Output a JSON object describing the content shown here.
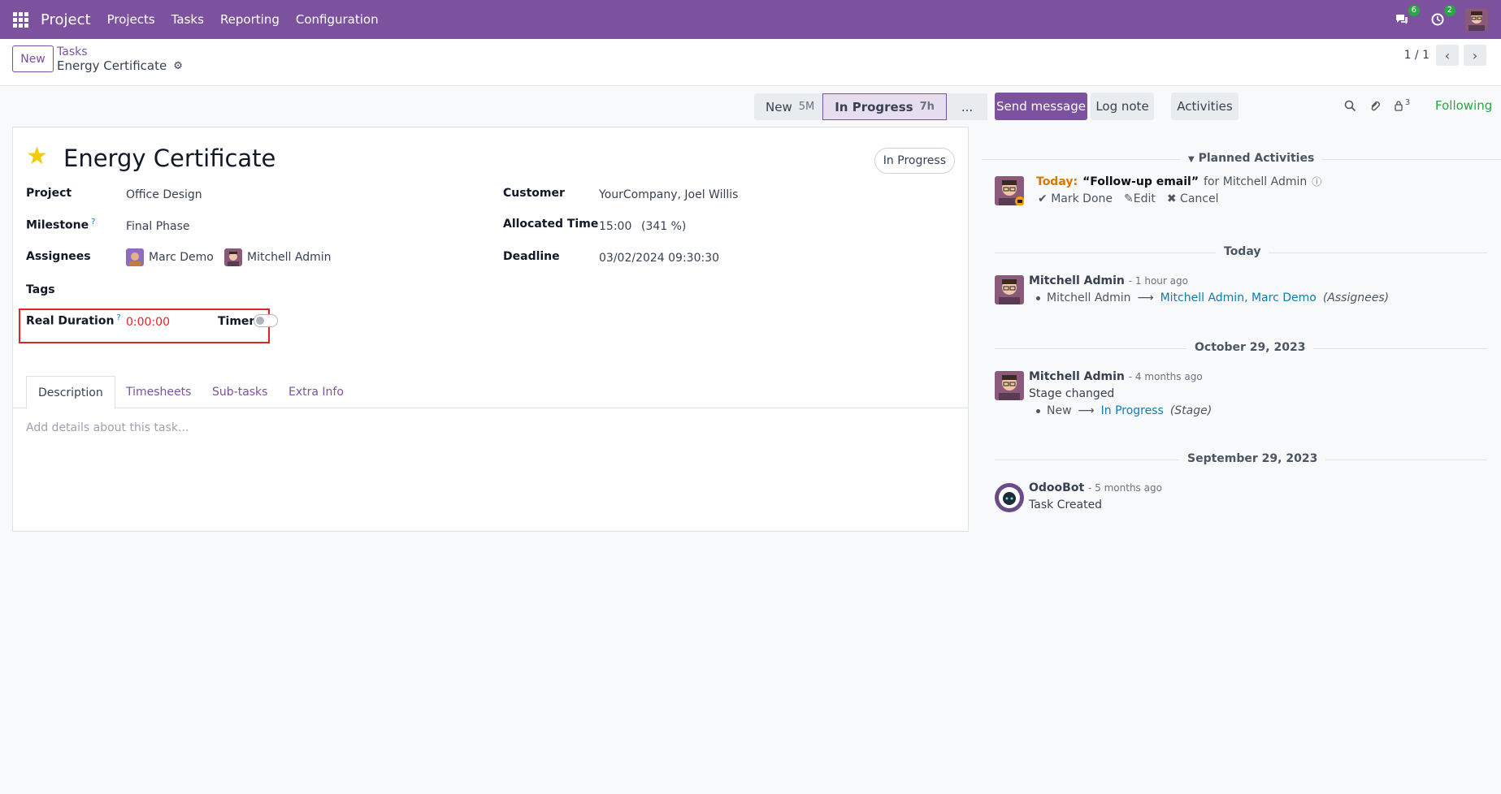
{
  "navbar": {
    "app_name": "Project",
    "menu": [
      "Projects",
      "Tasks",
      "Reporting",
      "Configuration"
    ],
    "messages_count": "6",
    "activities_count": "2",
    "background": "#7c519e"
  },
  "control_panel": {
    "new_label": "New",
    "breadcrumb_parent": "Tasks",
    "breadcrumb_current": "Energy Certificate",
    "pager": "1 / 1"
  },
  "statusbar": {
    "stages": [
      {
        "label": "New",
        "duration": "5M"
      },
      {
        "label": "In Progress",
        "duration": "7h"
      }
    ],
    "more_label": "..."
  },
  "form": {
    "title": "Energy Certificate",
    "state_badge": "In Progress",
    "fields": {
      "project_label": "Project",
      "project_value": "Office Design",
      "milestone_label": "Milestone",
      "milestone_value": "Final Phase",
      "assignees_label": "Assignees",
      "assignees": [
        "Marc Demo",
        "Mitchell Admin"
      ],
      "tags_label": "Tags",
      "real_duration_label": "Real Duration",
      "real_duration_value": "0:00:00",
      "timer_label": "Timer:",
      "customer_label": "Customer",
      "customer_value": "YourCompany, Joel Willis",
      "allocated_label": "Allocated Time",
      "allocated_value": "15:00",
      "allocated_pct": "(341 %)",
      "deadline_label": "Deadline",
      "deadline_value": "03/02/2024 09:30:30",
      "help_mark": "?"
    },
    "tabs": [
      "Description",
      "Timesheets",
      "Sub-tasks",
      "Extra Info"
    ],
    "description_placeholder": "Add details about this task..."
  },
  "chatter": {
    "send_message": "Send message",
    "log_note": "Log note",
    "activities": "Activities",
    "followers_count": "3",
    "following": "Following",
    "planned_title": "Planned Activities",
    "planned": {
      "when": "Today:",
      "summary": "“Follow-up email”",
      "for": "for Mitchell Admin",
      "actions": [
        "Mark Done",
        "Edit",
        "Cancel"
      ]
    },
    "groups": [
      {
        "date": "Today",
        "author": "Mitchell Admin",
        "ago": "- 1 hour ago",
        "text": "",
        "old": "Mitchell Admin",
        "new": "Mitchell Admin, Marc Demo",
        "field": "(Assignees)"
      },
      {
        "date": "October 29, 2023",
        "author": "Mitchell Admin",
        "ago": "- 4 months ago",
        "text": "Stage changed",
        "old": "New",
        "new": "In Progress",
        "field": "(Stage)"
      },
      {
        "date": "September 29, 2023",
        "author": "OdooBot",
        "ago": "- 5 months ago",
        "text": "Task Created"
      }
    ]
  }
}
